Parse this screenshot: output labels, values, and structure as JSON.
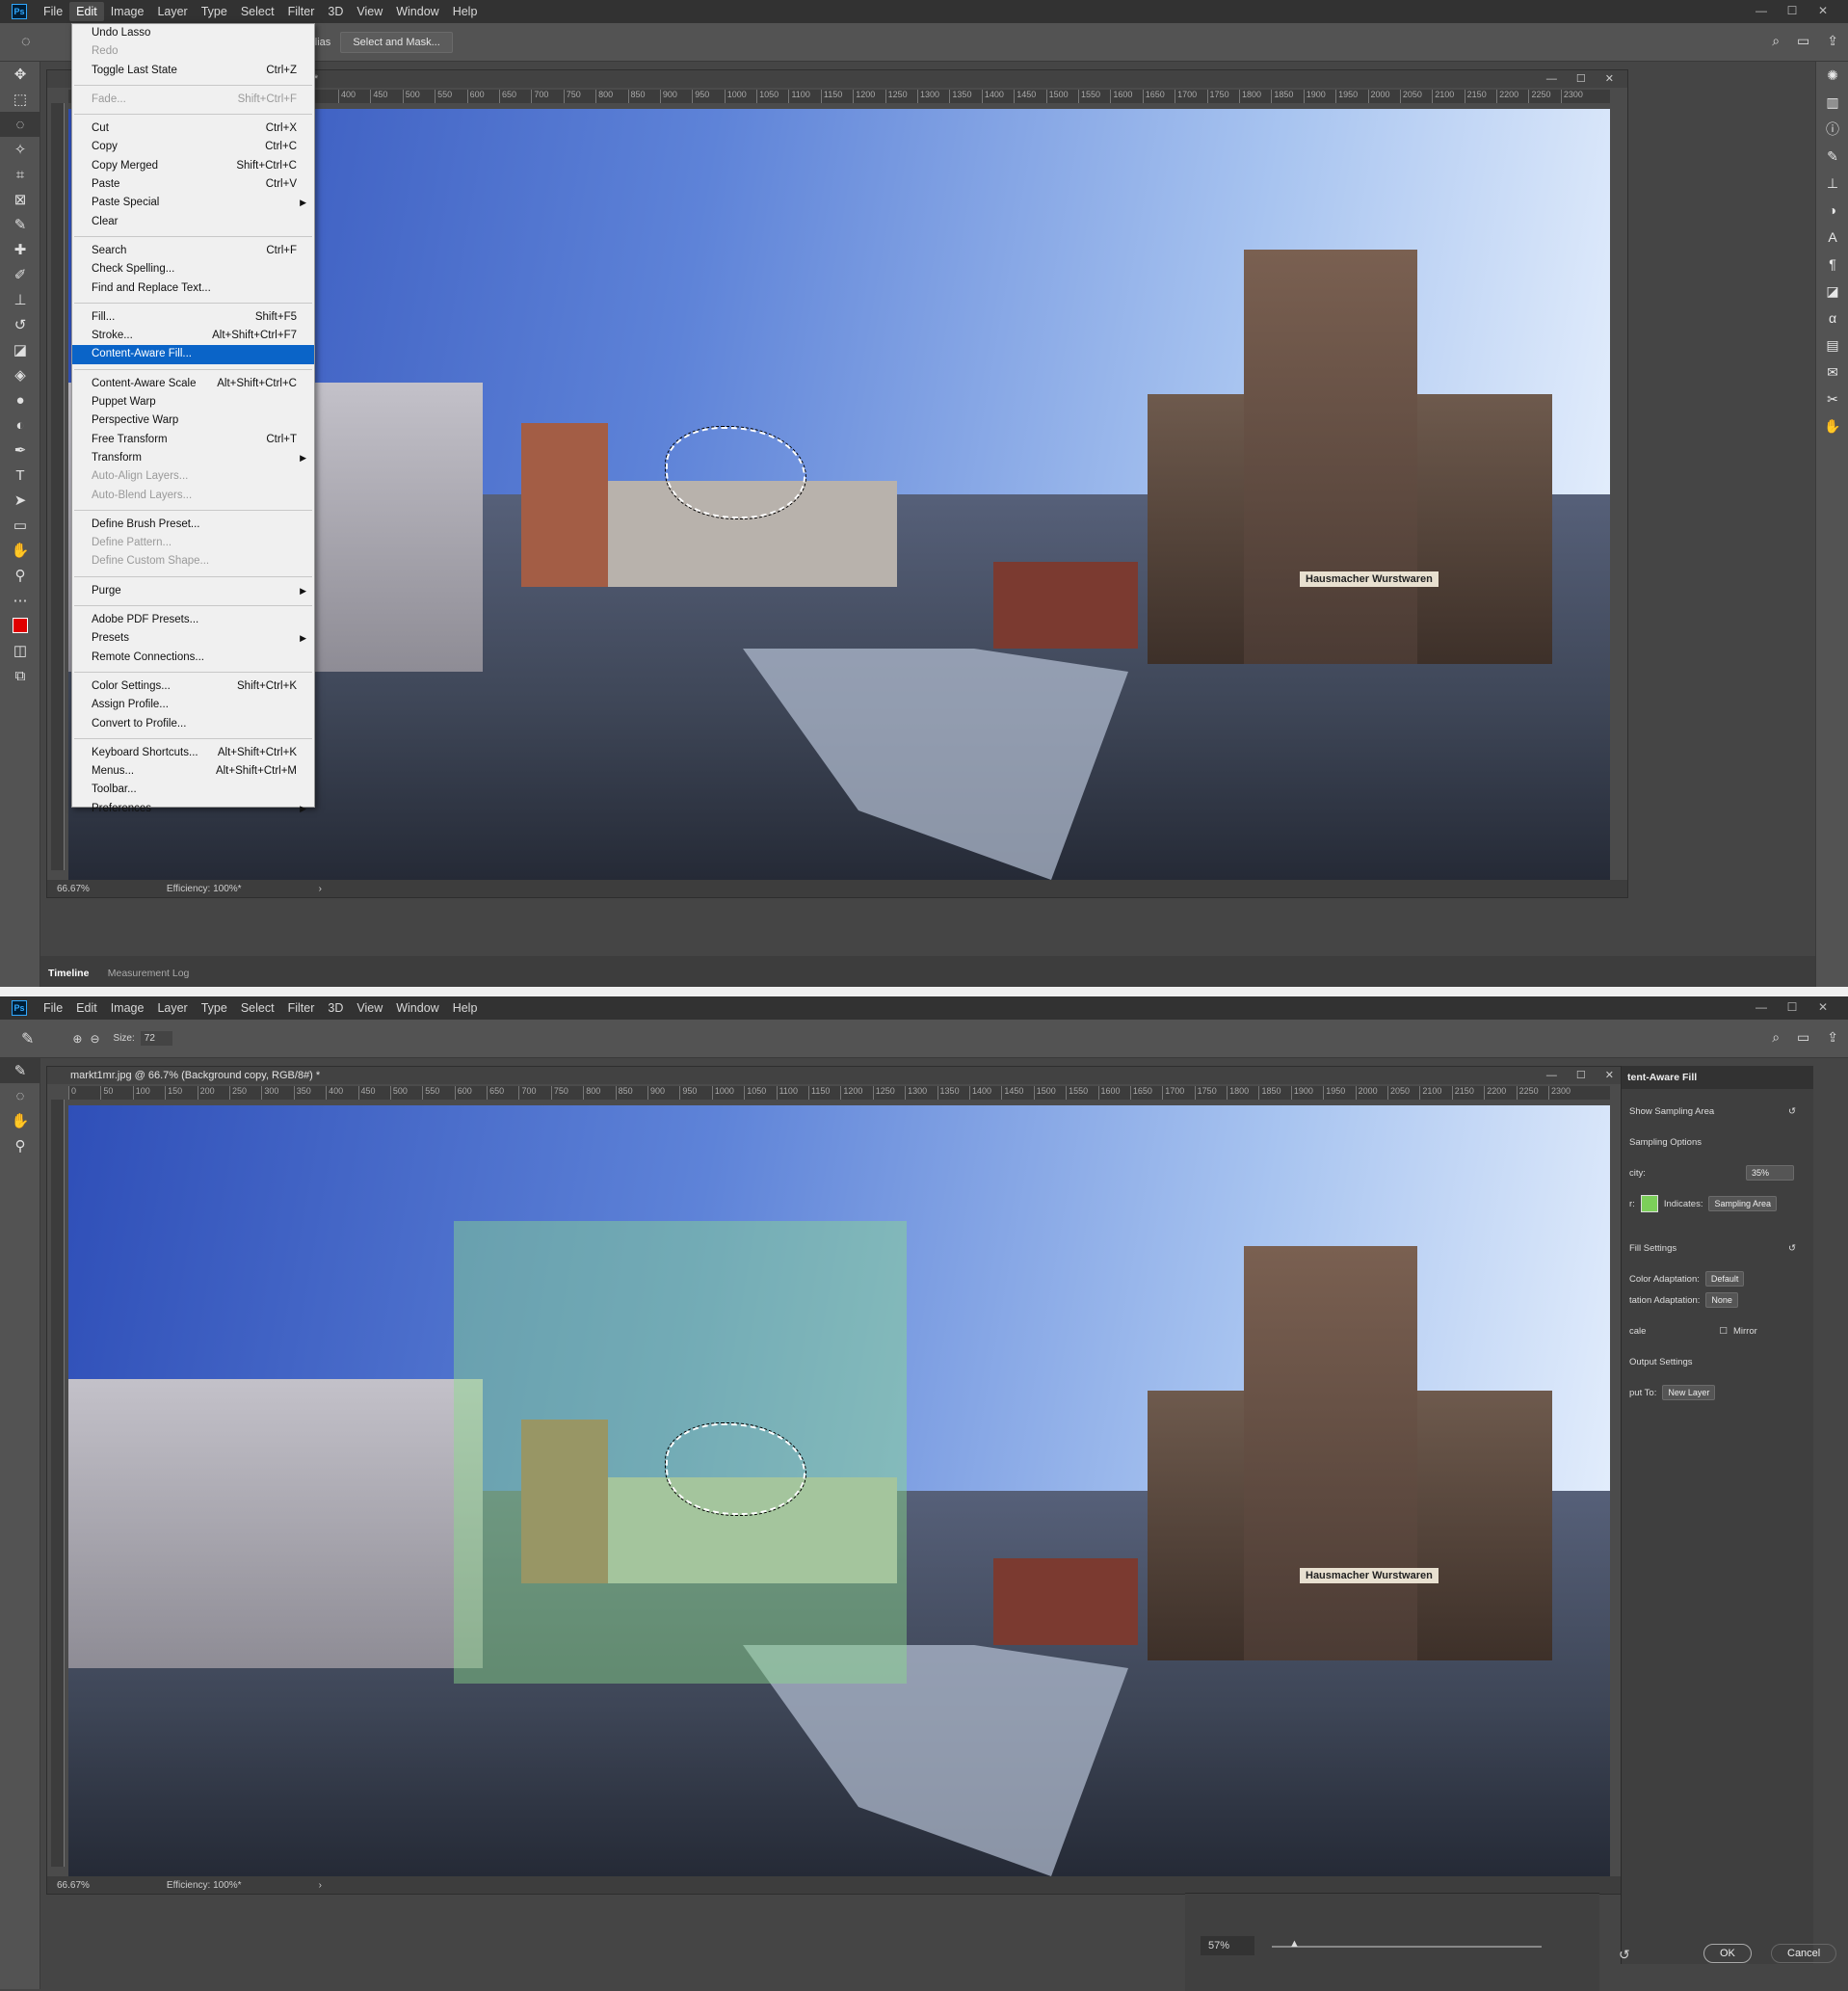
{
  "app": {
    "logo": "Ps"
  },
  "menus": [
    "File",
    "Edit",
    "Image",
    "Layer",
    "Type",
    "Select",
    "Filter",
    "3D",
    "View",
    "Window",
    "Help"
  ],
  "window_controls": [
    "—",
    "☐",
    "✕"
  ],
  "shot1": {
    "options": {
      "anti_alias": "ti-alias",
      "select_mask": "Select and Mask..."
    },
    "doc_title_fragment": "#) *",
    "status": {
      "zoom": "66.67%",
      "efficiency": "Efficiency: 100%*"
    },
    "timeline_tabs": [
      "Timeline",
      "Measurement Log"
    ],
    "edit_menu": [
      {
        "label": "Undo Lasso",
        "shortcut": "",
        "dis": false
      },
      {
        "label": "Redo",
        "shortcut": "",
        "dis": true
      },
      {
        "label": "Toggle Last State",
        "shortcut": "Ctrl+Z",
        "dis": false
      },
      {
        "sep": true
      },
      {
        "label": "Fade...",
        "shortcut": "Shift+Ctrl+F",
        "dis": true
      },
      {
        "sep": true
      },
      {
        "label": "Cut",
        "shortcut": "Ctrl+X"
      },
      {
        "label": "Copy",
        "shortcut": "Ctrl+C"
      },
      {
        "label": "Copy Merged",
        "shortcut": "Shift+Ctrl+C"
      },
      {
        "label": "Paste",
        "shortcut": "Ctrl+V"
      },
      {
        "label": "Paste Special",
        "shortcut": "",
        "sub": true
      },
      {
        "label": "Clear",
        "shortcut": ""
      },
      {
        "sep": true
      },
      {
        "label": "Search",
        "shortcut": "Ctrl+F"
      },
      {
        "label": "Check Spelling...",
        "shortcut": ""
      },
      {
        "label": "Find and Replace Text...",
        "shortcut": ""
      },
      {
        "sep": true
      },
      {
        "label": "Fill...",
        "shortcut": "Shift+F5"
      },
      {
        "label": "Stroke...",
        "shortcut": "Alt+Shift+Ctrl+F7"
      },
      {
        "label": "Content-Aware Fill...",
        "shortcut": "",
        "hl": true
      },
      {
        "sep": true
      },
      {
        "label": "Content-Aware Scale",
        "shortcut": "Alt+Shift+Ctrl+C"
      },
      {
        "label": "Puppet Warp",
        "shortcut": ""
      },
      {
        "label": "Perspective Warp",
        "shortcut": ""
      },
      {
        "label": "Free Transform",
        "shortcut": "Ctrl+T"
      },
      {
        "label": "Transform",
        "shortcut": "",
        "sub": true
      },
      {
        "label": "Auto-Align Layers...",
        "shortcut": "",
        "dis": true
      },
      {
        "label": "Auto-Blend Layers...",
        "shortcut": "",
        "dis": true
      },
      {
        "sep": true
      },
      {
        "label": "Define Brush Preset...",
        "shortcut": ""
      },
      {
        "label": "Define Pattern...",
        "shortcut": "",
        "dis": true
      },
      {
        "label": "Define Custom Shape...",
        "shortcut": "",
        "dis": true
      },
      {
        "sep": true
      },
      {
        "label": "Purge",
        "shortcut": "",
        "sub": true
      },
      {
        "sep": true
      },
      {
        "label": "Adobe PDF Presets...",
        "shortcut": ""
      },
      {
        "label": "Presets",
        "shortcut": "",
        "sub": true
      },
      {
        "label": "Remote Connections...",
        "shortcut": ""
      },
      {
        "sep": true
      },
      {
        "label": "Color Settings...",
        "shortcut": "Shift+Ctrl+K"
      },
      {
        "label": "Assign Profile...",
        "shortcut": ""
      },
      {
        "label": "Convert to Profile...",
        "shortcut": ""
      },
      {
        "sep": true
      },
      {
        "label": "Keyboard Shortcuts...",
        "shortcut": "Alt+Shift+Ctrl+K"
      },
      {
        "label": "Menus...",
        "shortcut": "Alt+Shift+Ctrl+M"
      },
      {
        "label": "Toolbar...",
        "shortcut": ""
      },
      {
        "label": "Preferences",
        "shortcut": "",
        "sub": true
      }
    ]
  },
  "shot2": {
    "options": {
      "size_label": "Size:",
      "size_value": "72"
    },
    "doc_title": "markt1mr.jpg @ 66.7% (Background copy, RGB/8#) *",
    "status": {
      "zoom": "66.67%",
      "efficiency": "Efficiency: 100%*"
    },
    "panel": {
      "title": "tent-Aware Fill",
      "show_sampling": "Show Sampling Area",
      "sampling_options": "Sampling Options",
      "opacity_label": "city:",
      "opacity_value": "35%",
      "color_label": "r:",
      "indicates_label": "Indicates:",
      "indicates_value": "Sampling Area",
      "fill_settings": "Fill Settings",
      "color_adapt_label": "Color Adaptation:",
      "color_adapt_value": "Default",
      "rotation_adapt_label": "tation Adaptation:",
      "rotation_adapt_value": "None",
      "scale_label": "cale",
      "mirror_label": "Mirror",
      "output_settings": "Output Settings",
      "output_label": "put To:",
      "output_value": "New Layer",
      "ok": "OK",
      "cancel": "Cancel"
    },
    "preview_zoom": "57%",
    "overlay_color": "#7ccf5a"
  },
  "ruler_ticks": [
    "400",
    "450",
    "500",
    "550",
    "600",
    "650",
    "700",
    "750",
    "800",
    "850",
    "900",
    "950",
    "1000",
    "1050",
    "1100",
    "1150",
    "1200",
    "1250",
    "1300",
    "1350",
    "1400",
    "1450",
    "1500",
    "1550",
    "1600",
    "1650",
    "1700",
    "1750",
    "1800",
    "1850",
    "1900",
    "1950",
    "2000",
    "2050",
    "2100",
    "2150",
    "2200",
    "2250",
    "2300"
  ],
  "ruler_ticks2": [
    "0",
    "50",
    "100",
    "150",
    "200",
    "250",
    "300",
    "350",
    "400",
    "450",
    "500",
    "550",
    "600",
    "650",
    "700",
    "750",
    "800",
    "850",
    "900",
    "950",
    "1000",
    "1050",
    "1100",
    "1150",
    "1200",
    "1250",
    "1300",
    "1350",
    "1400",
    "1450",
    "1500",
    "1550",
    "1600",
    "1650",
    "1700",
    "1750",
    "1800",
    "1850",
    "1900",
    "1950",
    "2000",
    "2050",
    "2100",
    "2150",
    "2200",
    "2250",
    "2300"
  ],
  "shop_sign": "Hausmacher Wurstwaren"
}
